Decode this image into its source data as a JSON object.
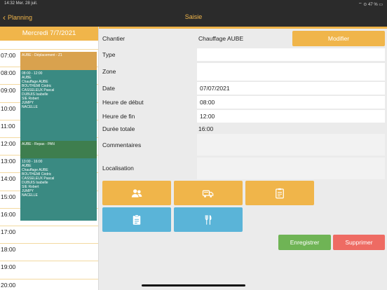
{
  "status_bar": {
    "time": "14:32  Mer. 28 juil.",
    "right": "⌔ ⊙ 47 % ▭"
  },
  "nav": {
    "back_label": "Planning",
    "title": "Saisie"
  },
  "planning": {
    "date": "Mercredi 7/7/2021",
    "hours": [
      "07:00",
      "08:00",
      "09:00",
      "10:00",
      "11:00",
      "12:00",
      "13:00",
      "14:00",
      "15:00",
      "16:00",
      "17:00",
      "18:00",
      "19:00",
      "20:00"
    ],
    "events": [
      {
        "lines": [
          "AUBE - Déplacement - Z1"
        ],
        "color": "#d9a24e"
      },
      {
        "lines": [
          "08:00 - 12:00",
          "AUBE",
          "Chauffage AUBE",
          "BOUTHEMI Cédric",
          "CASSELEUX Pascal",
          "DUBUIS Isabelle",
          "SIE Robert",
          "JUMPY",
          "NACELLE"
        ],
        "color": "#3a8a82"
      },
      {
        "lines": [
          "AUBE - Repas - PAN"
        ],
        "color": "#3e7e4e"
      },
      {
        "lines": [
          "13:00 - 16:00",
          "AUBE",
          "Chauffage AUBE",
          "BOUTHEMI Cédric",
          "CASSELEUX Pascal",
          "DUBUIS Isabelle",
          "SIE Robert",
          "JUMPY",
          "NACELLE"
        ],
        "color": "#3a8a82"
      }
    ]
  },
  "form": {
    "chantier_label": "Chantier",
    "chantier_value": "Chauffage AUBE",
    "modifier_label": "Modifier",
    "type_label": "Type",
    "type_value": "",
    "zone_label": "Zone",
    "zone_value": "",
    "date_label": "Date",
    "date_value": "07/07/2021",
    "start_label": "Heure de début",
    "start_value": "08:00",
    "end_label": "Heure de fin",
    "end_value": "12:00",
    "duration_label": "Durée totale",
    "duration_value": "16:00",
    "comments_label": "Commentaires",
    "comments_value": "",
    "location_label": "Localisation",
    "location_value": ""
  },
  "tiles": [
    {
      "icon": "people-icon",
      "color": "#f0b54a"
    },
    {
      "icon": "truck-icon",
      "color": "#f0b54a"
    },
    {
      "icon": "clipboard-icon",
      "color": "#f0b54a"
    },
    {
      "icon": "clipboard-icon",
      "color": "#5ab4d8"
    },
    {
      "icon": "utensils-icon",
      "color": "#5ab4d8"
    }
  ],
  "actions": {
    "save_label": "Enregistrer",
    "delete_label": "Supprimer"
  },
  "colors": {
    "accent": "#f0b54a",
    "save": "#6fb455",
    "delete": "#ee6b63",
    "tile_blue": "#5ab4d8"
  }
}
